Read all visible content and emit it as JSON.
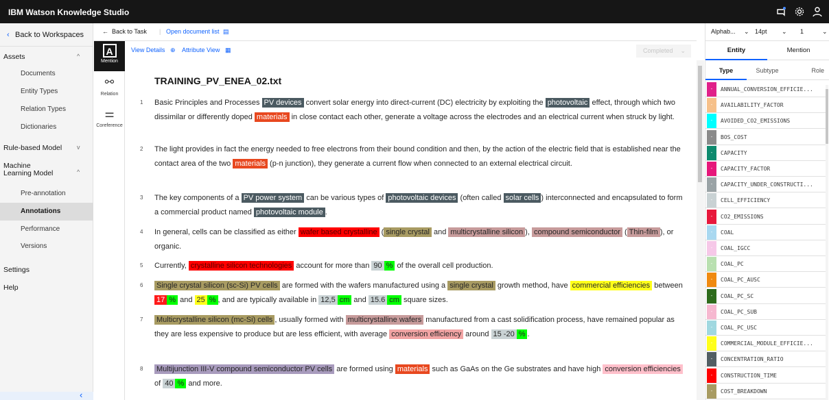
{
  "app": {
    "title": "IBM Watson Knowledge Studio"
  },
  "topbar": {
    "icons": [
      "notification-icon",
      "settings-icon",
      "user-icon"
    ]
  },
  "sidebar": {
    "back": "Back to Workspaces",
    "sections": [
      {
        "label": "Assets",
        "expanded": true
      },
      {
        "label": "Rule-based Model",
        "expanded": false
      },
      {
        "label": "Machine Learning Model",
        "expanded": true
      },
      {
        "label": "Settings"
      },
      {
        "label": "Help"
      }
    ],
    "assets_items": [
      "Documents",
      "Entity Types",
      "Relation Types",
      "Dictionaries"
    ],
    "ml_items": [
      "Pre-annotation",
      "Annotations",
      "Performance",
      "Versions"
    ],
    "collapse": "‹"
  },
  "subhead": {
    "back_to_task": "Back to Task",
    "open_list": "Open document list"
  },
  "tools": {
    "mention": "Mention",
    "relation": "Relation",
    "coreference": "Coreference"
  },
  "docbar": {
    "view_details": "View Details",
    "attribute_view": "Attribute View",
    "status": "Completed"
  },
  "document": {
    "title": "TRAINING_PV_ENEA_02.txt",
    "p1": {
      "n": "1",
      "t1": "Basic Principles and Processes ",
      "m1": "PV devices",
      "t2": " convert solar energy into direct-current (DC) electricity by exploiting the ",
      "m2": "photovoltaic",
      "t3": " effect, through which two dissimilar or differently doped ",
      "m3": "materials",
      "t4": " in close contact each other, generate a voltage across the electrodes and an electrical current when struck by light."
    },
    "p2": {
      "n": "2",
      "t1": "The light provides in fact the energy needed to free electrons from their bound condition and then, by the action of the electric field  that is established near the contact area of the two ",
      "m1": "materials",
      "t2": " (p-n junction), they generate a current flow when connected to an external electrical circuit."
    },
    "p3": {
      "n": "3",
      "t1": "The key components of a ",
      "m1": "PV power system",
      "t2": " can be various types of ",
      "m2": "photovoltaic devices",
      "t3": " (often called ",
      "m3": "solar cells",
      "t4": ") interconnected and encapsulated to form a commercial product named ",
      "m4": "photovoltaic module",
      "t5": "."
    },
    "p4": {
      "n": "4",
      "t1": "In general, cells can be classified as either ",
      "m1": "wafer based crystalline",
      "t2": " (",
      "m2": "single crystal",
      "t3": " and ",
      "m3": "multicrystalline silicon",
      "t4": "), ",
      "m4": "compound semiconductor",
      "t5": " (",
      "m5": "Thin-film",
      "t6": "), or organic."
    },
    "p5": {
      "n": "5",
      "t1": "Currently, ",
      "m1": "crystalline silicon technologies",
      "t2": " account for more than ",
      "m2": "90",
      "m3": "%",
      "t3": " of the overall cell production."
    },
    "p6": {
      "n": "6",
      "m1": "Single crystal silicon (sc-Si) PV cells",
      "t1": " are formed with the wafers manufactured using a ",
      "m2": "single crystal",
      "t2": " growth method, have ",
      "m3": "commercial efficiencies",
      "t3": " between ",
      "m4": "17",
      "m5": "%",
      "t4": " and ",
      "m6": "25",
      "m7": "%",
      "t5": ", and are typically available in ",
      "m8": "12,5",
      "m9": "cm",
      "t6": " and ",
      "m10": "15.6",
      "m11": "cm",
      "t7": " square sizes."
    },
    "p7": {
      "n": "7",
      "m1": "Multicrystalline silicon (mc-Si) cells",
      "t1": ", usually formed with ",
      "m2": "multicrystalline wafers",
      "t2": " manufactured from a cast solidification process, have remained popular as they are less expensive to produce but are less efficient, with average ",
      "m3": "conversion efficiency",
      "t3": " around ",
      "m4": "15 -20",
      "m5": "%",
      "t4": "."
    },
    "p8": {
      "n": "8",
      "m1": "Multijunction III-V compound semiconductor PV cells",
      "t1": " are formed using ",
      "m2": "materials",
      "t2": " such as GaAs on the Ge substrates and have high ",
      "m3": "conversion efficiencies",
      "t3": " of ",
      "m4": "40",
      "m5": "%",
      "t4": " and more."
    }
  },
  "right_panel": {
    "sort": "Alphab...",
    "font_size": "14pt",
    "page": "1",
    "tabs": [
      "Entity",
      "Mention"
    ],
    "subtabs": [
      "Type",
      "Subtype",
      "Role"
    ],
    "entity_types": [
      {
        "name": "ANNUAL_CONVERSION_EFFICIE...",
        "color": "#e0218a"
      },
      {
        "name": "AVAILABILITY_FACTOR",
        "color": "#f6c08a"
      },
      {
        "name": "AVOIDED_CO2_EMISSIONS",
        "color": "#00ffff"
      },
      {
        "name": "BOS_COST",
        "color": "#8a8a8a"
      },
      {
        "name": "CAPACITY",
        "color": "#0e8a6e"
      },
      {
        "name": "CAPACITY_FACTOR",
        "color": "#e6177a"
      },
      {
        "name": "CAPACITY_UNDER_CONSTRUCTI...",
        "color": "#9aa3a6"
      },
      {
        "name": "CELL_EFFICIENCY",
        "color": "#c9d2d4"
      },
      {
        "name": "CO2_EMISSIONS",
        "color": "#e8183c"
      },
      {
        "name": "COAL",
        "color": "#a9d8f0"
      },
      {
        "name": "COAL_IGCC",
        "color": "#f6c8e8"
      },
      {
        "name": "COAL_PC",
        "color": "#b9e0b0"
      },
      {
        "name": "COAL_PC_AUSC",
        "color": "#f08a10"
      },
      {
        "name": "COAL_PC_SC",
        "color": "#2e6b1c"
      },
      {
        "name": "COAL_PC_SUB",
        "color": "#f6b8d0"
      },
      {
        "name": "COAL_PC_USC",
        "color": "#a0d8e0"
      },
      {
        "name": "COMMERCIAL_MODULE_EFFICIE...",
        "color": "#ffff1a"
      },
      {
        "name": "CONCENTRATION_RATIO",
        "color": "#525e63"
      },
      {
        "name": "CONSTRUCTION_TIME",
        "color": "#ff0000"
      },
      {
        "name": "COST_BREAKDOWN",
        "color": "#a89b62"
      }
    ]
  }
}
